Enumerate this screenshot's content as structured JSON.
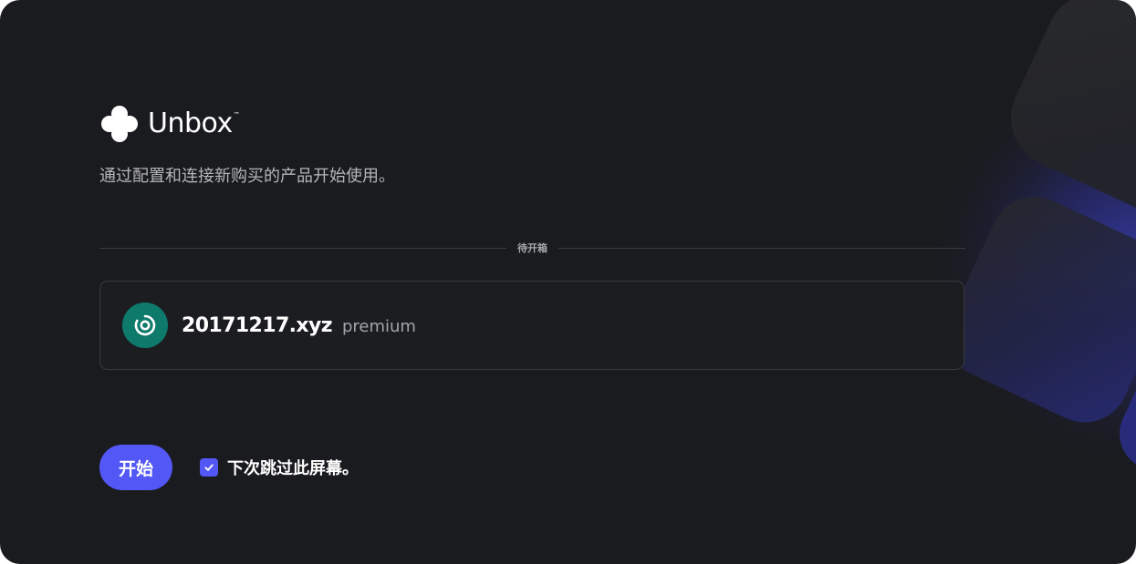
{
  "app": {
    "name": "Unbox",
    "trademark": "™",
    "subtitle": "通过配置和连接新购买的产品开始使用。",
    "accent_color": "#5257f5",
    "background_color": "#1a1b1e"
  },
  "section": {
    "divider_label": "待开箱"
  },
  "product": {
    "name": "20171217.xyz",
    "tier": "premium",
    "icon": "disc-icon",
    "icon_color": "#0e7a6c"
  },
  "actions": {
    "start_label": "开始",
    "skip_label": "下次跳过此屏幕。",
    "skip_checked": true
  }
}
